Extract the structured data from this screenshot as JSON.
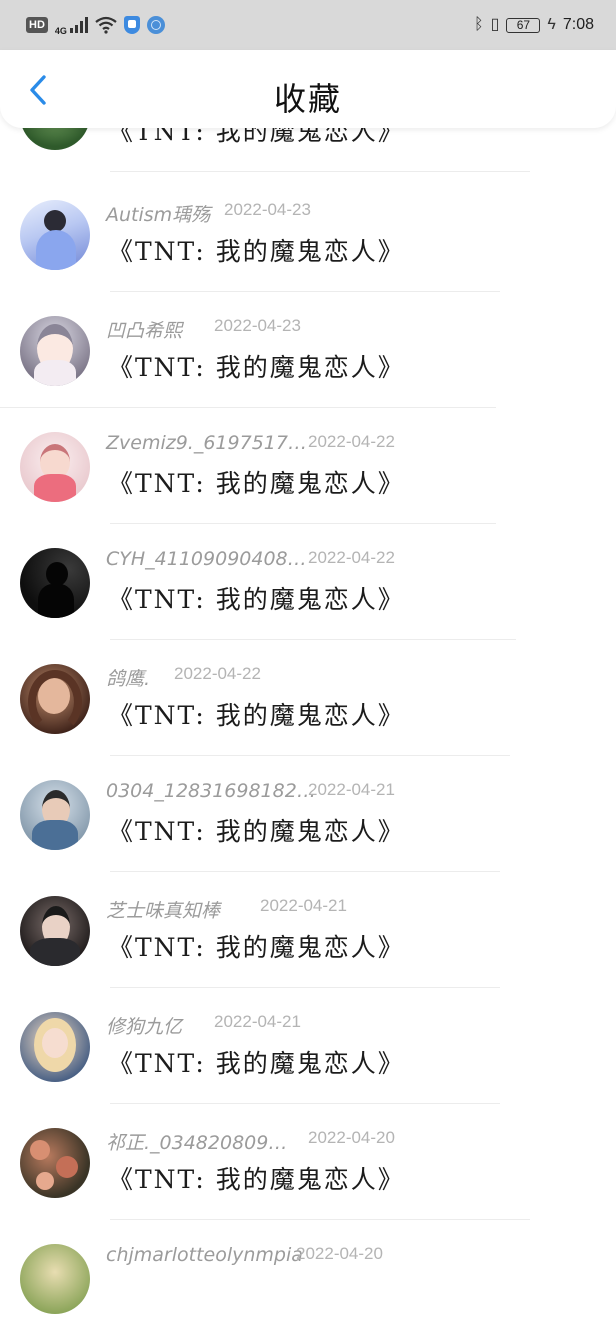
{
  "status_bar": {
    "hd": "HD",
    "network": "4G",
    "battery": "67",
    "time": "7:08"
  },
  "header": {
    "title": "收藏",
    "back_icon": "chevron-left-icon"
  },
  "accent_color": "#2a8be8",
  "items": [
    {
      "name": "",
      "date": "",
      "subject": "《TNT: 我的魔鬼恋人》"
    },
    {
      "name": "Autism瑀殇",
      "date": "2022-04-23",
      "subject": "《TNT: 我的魔鬼恋人》"
    },
    {
      "name": "凹凸希熙",
      "date": "2022-04-23",
      "subject": "《TNT: 我的魔鬼恋人》"
    },
    {
      "name": "Zvemiz9._6197517…",
      "date": "2022-04-22",
      "subject": "《TNT: 我的魔鬼恋人》"
    },
    {
      "name": "CYH_41109090408…",
      "date": "2022-04-22",
      "subject": "《TNT: 我的魔鬼恋人》"
    },
    {
      "name": "鸽鹰.",
      "date": "2022-04-22",
      "subject": "《TNT: 我的魔鬼恋人》"
    },
    {
      "name": "0304_12831698182…",
      "date": "2022-04-21",
      "subject": "《TNT: 我的魔鬼恋人》"
    },
    {
      "name": "芝士味真知棒",
      "date": "2022-04-21",
      "subject": "《TNT: 我的魔鬼恋人》"
    },
    {
      "name": "修狗九亿",
      "date": "2022-04-21",
      "subject": "《TNT: 我的魔鬼恋人》"
    },
    {
      "name": "祁正._034820809…",
      "date": "2022-04-20",
      "subject": "《TNT: 我的魔鬼恋人》"
    },
    {
      "name": "chjmarlotteolynmpia",
      "date": "2022-04-20",
      "subject": ""
    }
  ]
}
